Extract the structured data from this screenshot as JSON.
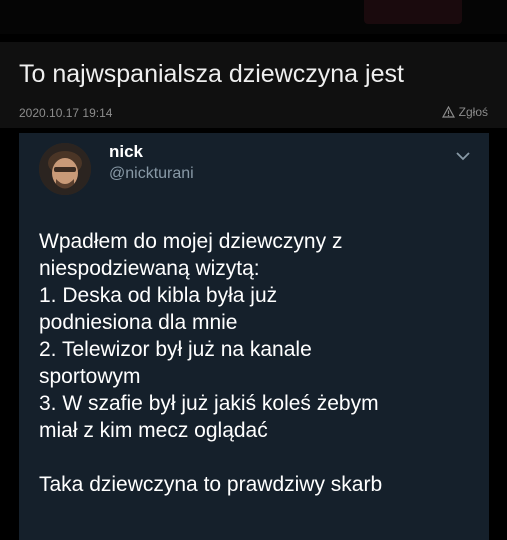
{
  "post": {
    "title": "To najwspanialsza dziewczyna jest",
    "date": "2020.10.17 19:14",
    "report_label": "Zgłoś"
  },
  "tweet": {
    "name": "nick",
    "handle": "@nickturani",
    "lines": [
      "Wpadłem do mojej dziewczyny z",
      "niespodziewaną wizytą:",
      "1. Deska od kibla była już",
      "podniesiona dla mnie",
      "2. Telewizor był już na kanale",
      "sportowym",
      "3. W szafie był już jakiś koleś żebym",
      "miał z kim mecz oglądać"
    ],
    "closing": "Taka dziewczyna to prawdziwy skarb"
  },
  "icons": {
    "report": "warning-triangle-icon",
    "menu": "chevron-down-icon"
  },
  "colors": {
    "page_bg": "#000000",
    "tweet_bg": "#15202b",
    "handle": "#8899a6"
  }
}
